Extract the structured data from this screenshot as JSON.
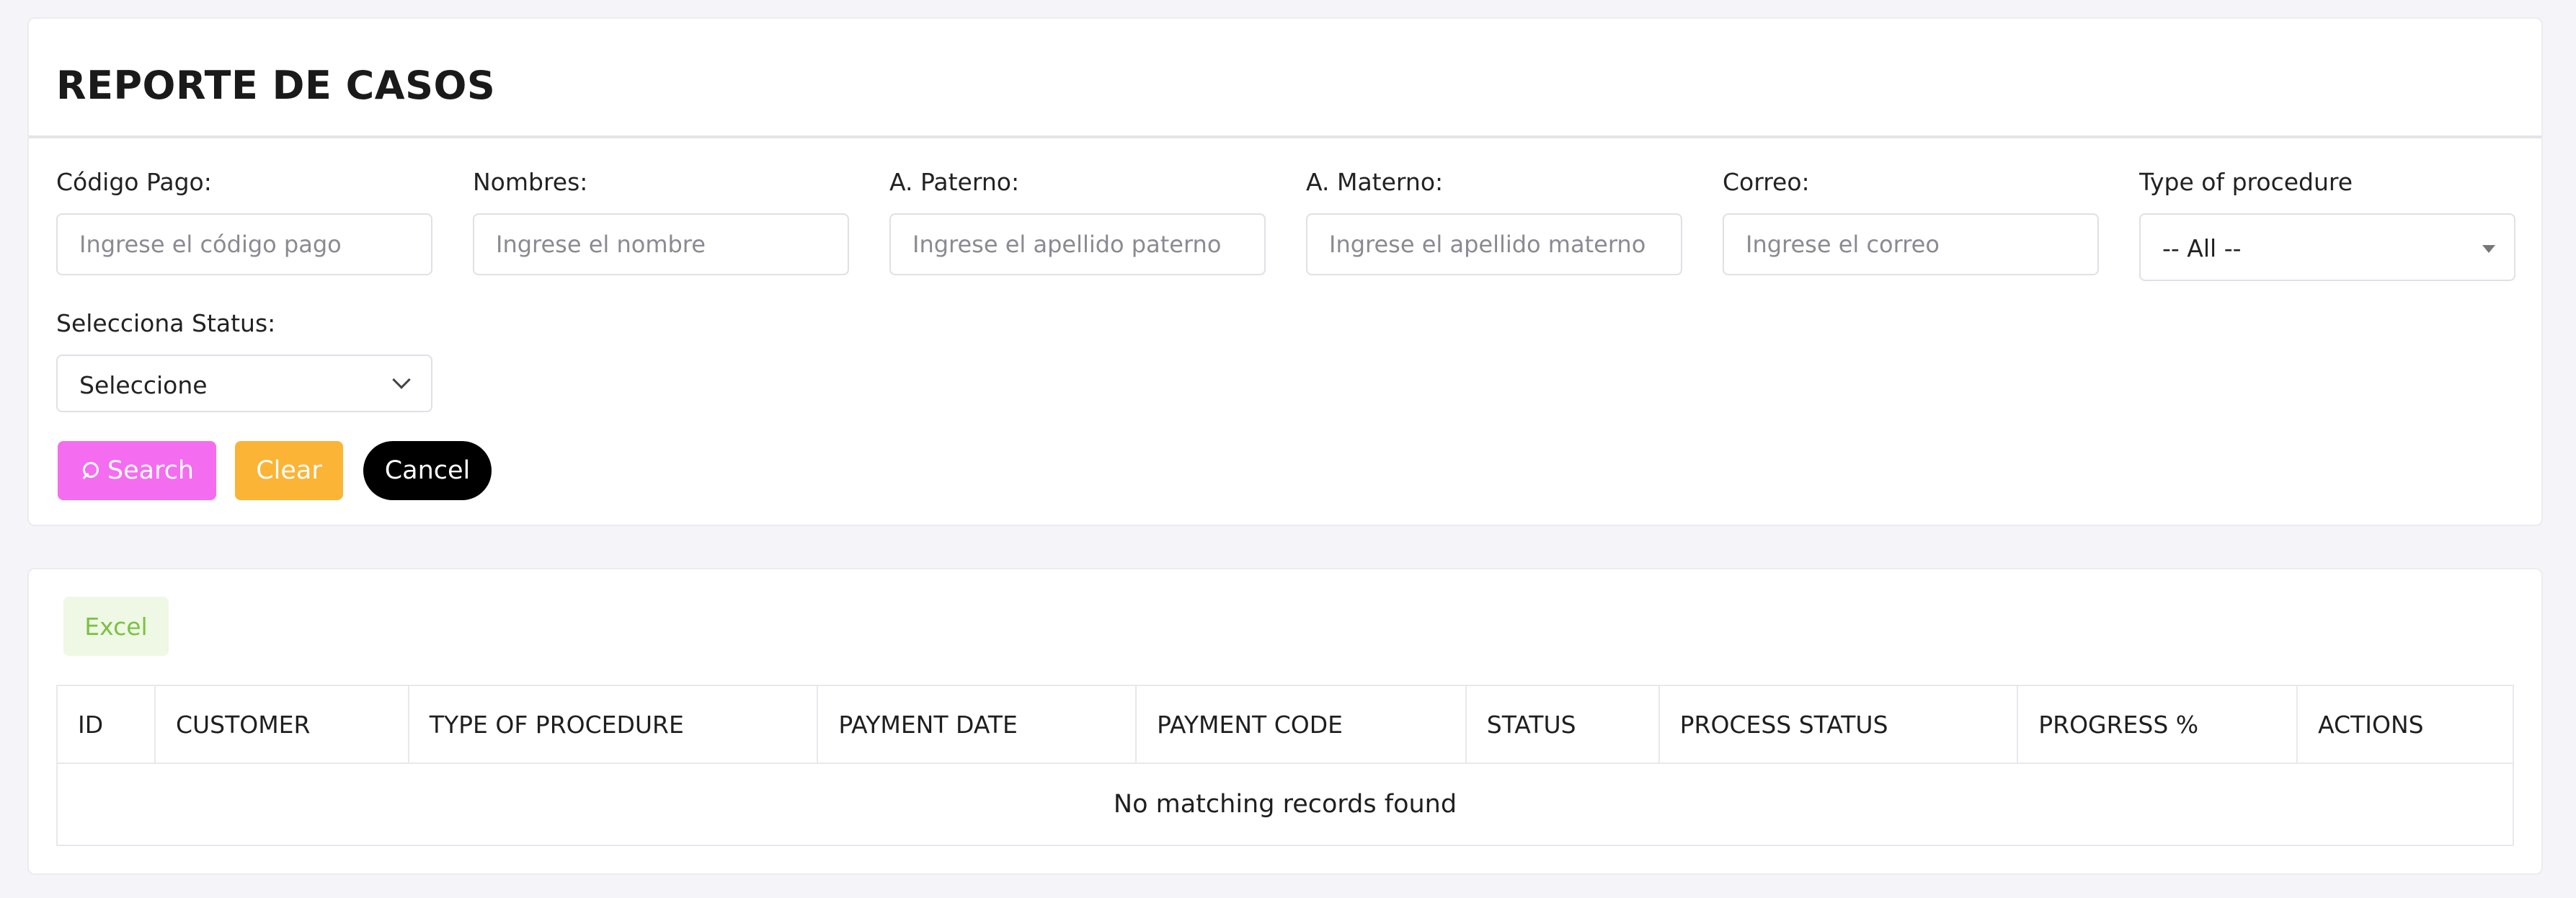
{
  "page": {
    "title": "REPORTE DE CASOS"
  },
  "filters": {
    "codigo_pago": {
      "label": "Código Pago:",
      "placeholder": "Ingrese el código pago"
    },
    "nombres": {
      "label": "Nombres:",
      "placeholder": "Ingrese el nombre"
    },
    "paterno": {
      "label": "A. Paterno:",
      "placeholder": "Ingrese el apellido paterno"
    },
    "materno": {
      "label": "A. Materno:",
      "placeholder": "Ingrese el apellido materno"
    },
    "correo": {
      "label": "Correo:",
      "placeholder": "Ingrese el correo"
    },
    "procedure": {
      "label": "Type of procedure",
      "selected": "-- All --"
    },
    "status": {
      "label": "Selecciona Status:",
      "selected": "Seleccione"
    }
  },
  "actions": {
    "search_label": "Search",
    "clear_label": "Clear",
    "cancel_label": "Cancel",
    "excel_label": "Excel"
  },
  "table": {
    "columns": [
      "ID",
      "CUSTOMER",
      "TYPE OF PROCEDURE",
      "PAYMENT DATE",
      "PAYMENT CODE",
      "STATUS",
      "PROCESS STATUS",
      "PROGRESS %",
      "ACTIONS"
    ],
    "empty_message": "No matching records found"
  },
  "colors": {
    "search_button": "#f46cf0",
    "clear_button": "#fbb436",
    "cancel_button": "#000000",
    "excel_text": "#7cc142",
    "excel_bg": "#eef8e4",
    "page_background": "#f5f5f9"
  },
  "icons": {
    "search": "search-icon",
    "procedure_dropdown": "caret-down-icon",
    "status_dropdown": "chevron-down-icon"
  }
}
